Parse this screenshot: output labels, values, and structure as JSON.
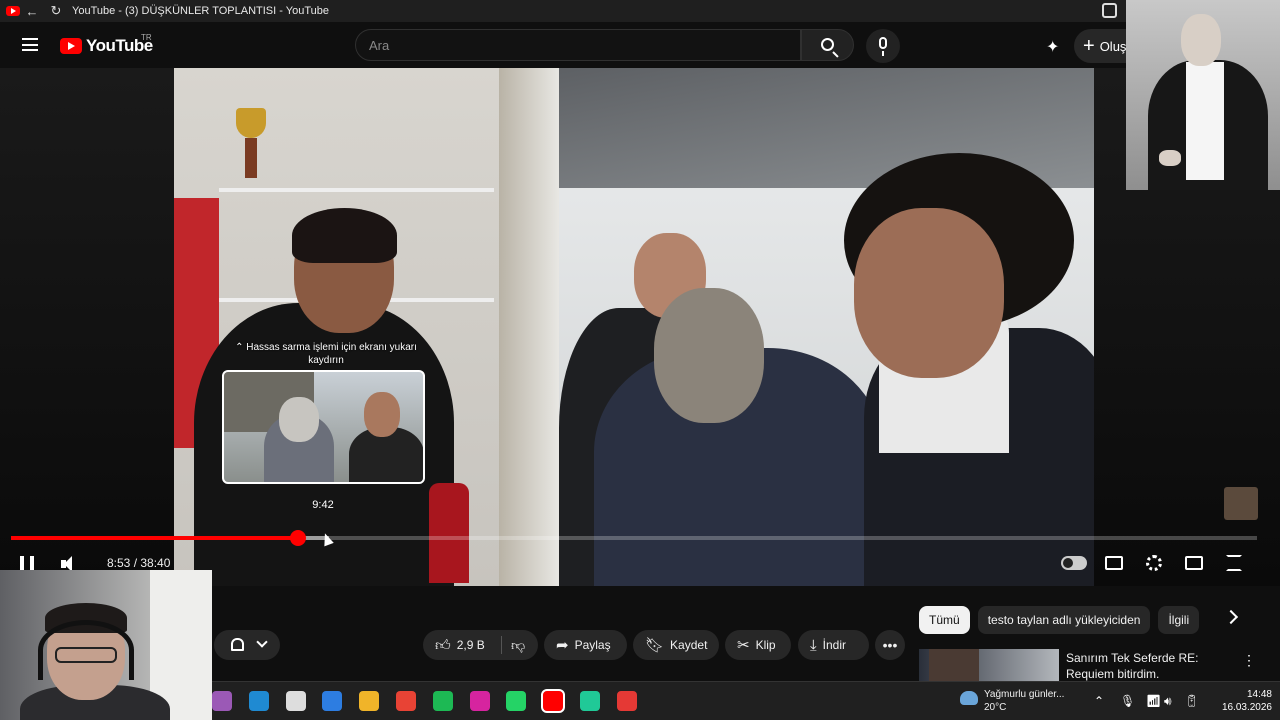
{
  "window": {
    "title": "YouTube - (3) DÜŞKÜNLER TOPLANTISI - YouTube"
  },
  "masthead": {
    "logo_text": "YouTube",
    "country_code": "TR",
    "search_placeholder": "Ara",
    "create_label": "Oluş"
  },
  "player": {
    "scrub_hint": "⌃ Hassas sarma işlemi için ekranı yukarı kaydırın",
    "scrub_time": "9:42",
    "time_current": "8:53",
    "time_total": "38:40",
    "time_display": "8:53 / 38:40",
    "progress_fraction": 0.23,
    "buffer_fraction": 0.255
  },
  "actions": {
    "likes": "2,9 B",
    "share": "Paylaş",
    "save": "Kaydet",
    "clip": "Klip",
    "download": "İndir"
  },
  "chips": [
    "Tümü",
    "testo taylan adlı yükleyiciden",
    "İlgili"
  ],
  "recommendation": {
    "title": "Sanırım Tek Seferde RE: Requiem bitirdim."
  },
  "taskbar": {
    "weather_text": "Yağmurlu günler...",
    "temperature": "20°C",
    "time": "14:48",
    "date": "16.03.2026",
    "app_colors": [
      "#9b59b6",
      "#1f8ad2",
      "#dddddd",
      "#2d7de1",
      "#f0b429",
      "#e84335",
      "#1db954",
      "#d6249f",
      "#25d366",
      "#ff0000",
      "#20c997",
      "#e53935"
    ]
  },
  "colors": {
    "accent": "#ff0000",
    "background": "#0f0f0f",
    "pill": "#272727"
  }
}
